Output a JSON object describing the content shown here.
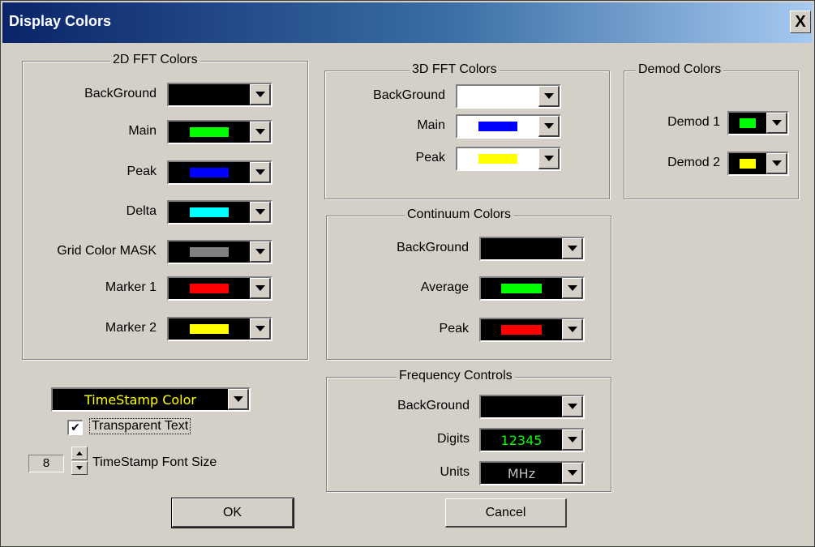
{
  "window": {
    "title": "Display Colors",
    "close_glyph": "X"
  },
  "fft2d": {
    "legend": "2D FFT Colors",
    "rows": [
      {
        "label": "BackGround",
        "color": "#000000"
      },
      {
        "label": "Main",
        "color": "#00ff00"
      },
      {
        "label": "Peak",
        "color": "#0000ff"
      },
      {
        "label": "Delta",
        "color": "#00ffff"
      },
      {
        "label": "Grid Color MASK",
        "color": "#808080"
      },
      {
        "label": "Marker 1",
        "color": "#ff0000"
      },
      {
        "label": "Marker 2",
        "color": "#ffff00"
      }
    ]
  },
  "fft3d": {
    "legend": "3D FFT Colors",
    "rows": [
      {
        "label": "BackGround",
        "color": "#ffffff"
      },
      {
        "label": "Main",
        "color": "#0000ff"
      },
      {
        "label": "Peak",
        "color": "#ffff00"
      }
    ]
  },
  "demod": {
    "legend": "Demod Colors",
    "rows": [
      {
        "label": "Demod 1",
        "color": "#00ff00"
      },
      {
        "label": "Demod 2",
        "color": "#ffff00"
      }
    ]
  },
  "continuum": {
    "legend": "Continuum Colors",
    "rows": [
      {
        "label": "BackGround",
        "color": "#000000"
      },
      {
        "label": "Average",
        "color": "#00ff00"
      },
      {
        "label": "Peak",
        "color": "#ff0000"
      }
    ]
  },
  "freq": {
    "legend": "Frequency Controls",
    "rows": [
      {
        "label": "BackGround",
        "value": ""
      },
      {
        "label": "Digits",
        "value": "12345",
        "text_color": "#00ff00"
      },
      {
        "label": "Units",
        "value": "MHz",
        "text_color": "#c0c0c0"
      }
    ]
  },
  "timestamp": {
    "combo_value": "TimeStamp Color",
    "combo_text_color": "#ffff00",
    "transparent_label": "Transparent Text",
    "transparent_checked": "✔",
    "font_size_value": "8",
    "font_size_label": "TimeStamp Font Size"
  },
  "buttons": {
    "ok": "OK",
    "cancel": "Cancel"
  }
}
